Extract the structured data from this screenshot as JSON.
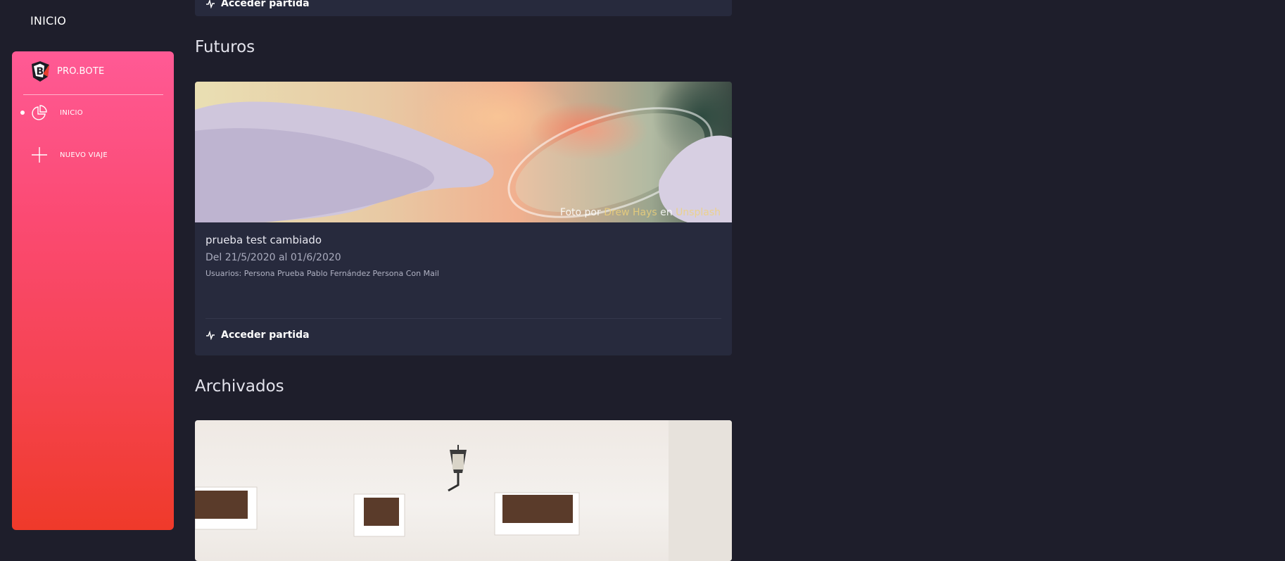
{
  "page": {
    "title": "INICIO"
  },
  "sidebar": {
    "brand": {
      "name": "PRO.BOTE",
      "logo_icon": "b-shield-logo"
    },
    "items": [
      {
        "label": "INICIO",
        "icon": "pie-chart-icon",
        "active": true
      },
      {
        "label": "NUEVO VIAJE",
        "icon": "plus-icon",
        "active": false
      }
    ]
  },
  "top_card": {
    "access_label": "Acceder partida"
  },
  "sections": {
    "futuros": {
      "title": "Futuros",
      "card": {
        "photo_credit": {
          "prefix": "Foto por",
          "author": "Drew Hays",
          "connector": "en",
          "site": "Unsplash"
        },
        "name": "prueba test cambiado",
        "dates": "Del 21/5/2020 al 01/6/2020",
        "users": "Usuarios: Persona Prueba Pablo Fernández Persona Con Mail",
        "access_label": "Acceder partida"
      }
    },
    "archivados": {
      "title": "Archivados"
    }
  },
  "colors": {
    "background": "#1e1e2b",
    "card": "#272a3d",
    "sidebar_top": "#ff5a95",
    "sidebar_bottom": "#ef3a2a",
    "credit_highlight": "#f1d27a"
  }
}
